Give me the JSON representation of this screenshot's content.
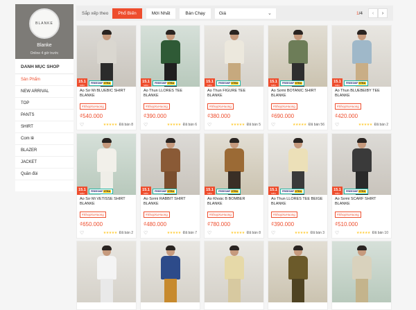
{
  "shop": {
    "logo_text": "BLANKE",
    "name": "Blanke",
    "online": "Online 4 giờ trước"
  },
  "categories": {
    "title": "DANH MỤC SHOP",
    "items": [
      "Sản Phẩm",
      "NEW ARRIVAL",
      "TOP",
      "PANTS",
      "SHIRT",
      "Com lê",
      "BLAZER",
      "JACKET",
      "Quần đùi"
    ],
    "active_index": 0
  },
  "sort": {
    "label": "Sắp xếp theo",
    "options": [
      "Phổ Biến",
      "Mới Nhất",
      "Bán Chạy"
    ],
    "active": "Phổ Biến",
    "price_label": "Giá"
  },
  "pager": {
    "current": "1",
    "total": "/4",
    "prev_icon": "‹",
    "next_icon": "›"
  },
  "badge": {
    "sale": "15.1",
    "sale_sub": "SIÊU SALE",
    "ship": "FREESHIP",
    "ship_extra": "XTRA"
  },
  "tag_label": "#ShopXuHuong",
  "location": "TP. Hồ Chí Minh",
  "colors": {
    "accent": "#ee4d2d",
    "star": "#ffce3d"
  },
  "products": [
    {
      "name": "Áo Sơ Mi BLUEBIC SHIRT BLANKE",
      "price": "₫540.000",
      "sold": "Đã bán 8",
      "top": "#dad7d0",
      "bottom": "#2b2b2b",
      "bg": "bg-a"
    },
    {
      "name": "Áo Thun LLORES TEE BLANKE",
      "price": "₫390.000",
      "sold": "Đã bán 6",
      "top": "#2f5a36",
      "bottom": "#1f1f1f",
      "bg": "bg-c"
    },
    {
      "name": "Áo Thun FIGURE TEE BLANKE",
      "price": "₫380.000",
      "sold": "Đã bán 5",
      "top": "#ece8dd",
      "bottom": "#c6a97e",
      "bg": "bg-b"
    },
    {
      "name": "Áo Sơmi BOTANIC SHIRT BLANKE",
      "price": "₫690.000",
      "sold": "Đã bán 56",
      "top": "#6d7d58",
      "bottom": "#2e2e2e",
      "bg": "bg-d"
    },
    {
      "name": "Áo Thun BLUEBEIBY TEE BLANKE",
      "price": "₫420.000",
      "sold": "Đã bán 2",
      "top": "#9fb8c9",
      "bottom": "#c9ae86",
      "bg": "bg-b"
    },
    {
      "name": "Áo Sơ Mi VETISSE SHIRT BLANKE",
      "price": "₫650.000",
      "sold": "Đã bán 2",
      "top": "#f2f0ea",
      "bottom": "#efeee8",
      "bg": "bg-c"
    },
    {
      "name": "Áo Sơmi RABBIT SHIRT BLANKE",
      "price": "₫480.000",
      "sold": "Đã bán 7",
      "top": "#8a5a36",
      "bottom": "#7a4e2e",
      "bg": "bg-a"
    },
    {
      "name": "Áo Khoác B BOMBER BLANKE",
      "price": "₫780.000",
      "sold": "Đã bán 8",
      "top": "#9b6a35",
      "bottom": "#3a2f26",
      "bg": "bg-d"
    },
    {
      "name": "Áo Thun LLORES TEE BEIGE BLANKE",
      "price": "₫390.000",
      "sold": "Đã bán 3",
      "top": "#ece0b8",
      "bottom": "#3a3a3a",
      "bg": "bg-b"
    },
    {
      "name": "Áo Sơmi SCARF SHIRT BLANKE",
      "price": "₫510.000",
      "sold": "Đã bán 10",
      "top": "#3a3a3a",
      "bottom": "#2a2a2a",
      "bg": "bg-a"
    },
    {
      "name": "",
      "price": "",
      "sold": "",
      "top": "#f4f4f4",
      "bottom": "#e9e9e9",
      "bg": "bg-b"
    },
    {
      "name": "",
      "price": "",
      "sold": "",
      "top": "#2d4b8a",
      "bottom": "#c78a2e",
      "bg": "bg-b"
    },
    {
      "name": "",
      "price": "",
      "sold": "",
      "top": "#e6d9a8",
      "bottom": "#d7c9a0",
      "bg": "bg-b"
    },
    {
      "name": "",
      "price": "",
      "sold": "",
      "top": "#6b5a2a",
      "bottom": "#4f4322",
      "bg": "bg-d"
    },
    {
      "name": "",
      "price": "",
      "sold": "",
      "top": "#d9d2bd",
      "bottom": "#c4b48c",
      "bg": "bg-c"
    }
  ]
}
